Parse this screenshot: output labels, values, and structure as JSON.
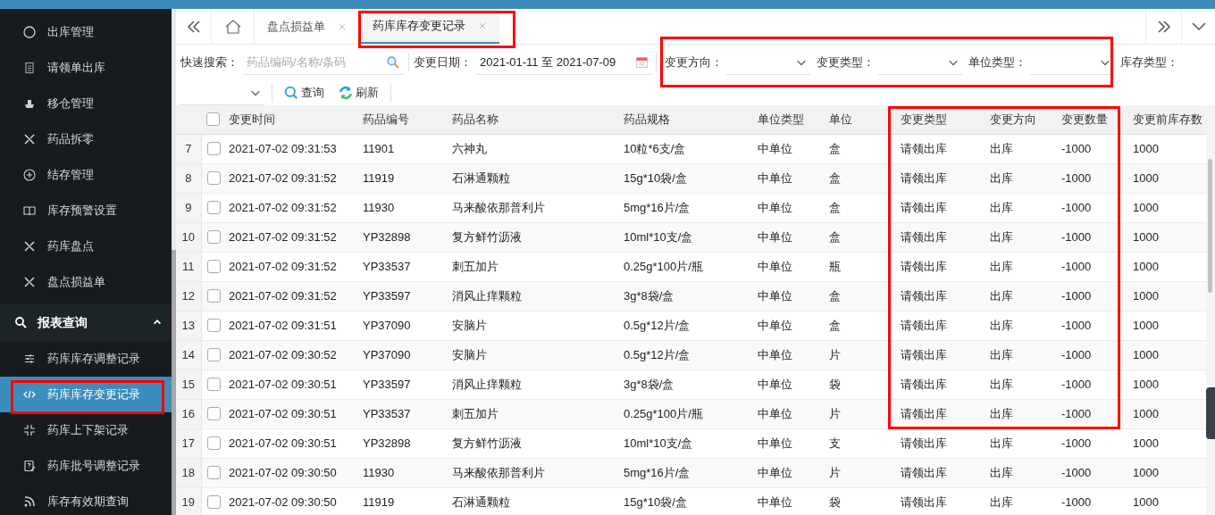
{
  "sidebar": {
    "items": [
      {
        "label": "出库管理",
        "selected": false
      },
      {
        "label": "请领单出库",
        "selected": false
      },
      {
        "label": "移仓管理",
        "selected": false
      },
      {
        "label": "药品拆零",
        "selected": false
      },
      {
        "label": "结存管理",
        "selected": false
      },
      {
        "label": "库存预警设置",
        "selected": false
      },
      {
        "label": "药库盘点",
        "selected": false
      },
      {
        "label": "盘点损益单",
        "selected": false
      }
    ],
    "section": {
      "label": "报表查询",
      "expanded": true,
      "children": [
        {
          "label": "药库库存调整记录",
          "selected": false
        },
        {
          "label": "药库库存变更记录",
          "selected": true
        },
        {
          "label": "药库上下架记录",
          "selected": false
        },
        {
          "label": "药库批号调整记录",
          "selected": false
        },
        {
          "label": "库存有效期查询",
          "selected": false
        }
      ]
    }
  },
  "tabs": [
    {
      "label": "盘点损益单",
      "selected": false
    },
    {
      "label": "药库库存变更记录",
      "selected": true
    }
  ],
  "filters": {
    "search": {
      "label": "快速搜索：",
      "placeholder": "药品编码/名称/条码"
    },
    "date": {
      "label": "变更日期：",
      "value": "2021-01-11 至 2021-07-09"
    },
    "selects": [
      {
        "label": "变更方向："
      },
      {
        "label": "变更类型："
      },
      {
        "label": "单位类型："
      },
      {
        "label": "库存类型："
      }
    ],
    "buttons": [
      {
        "kind": "search",
        "label": "查询"
      },
      {
        "kind": "refresh",
        "label": "刷新"
      }
    ]
  },
  "table": {
    "all_checked": false,
    "columns": [
      "变更时间",
      "药品编号",
      "药品名称",
      "药品规格",
      "单位类型",
      "单位",
      "变更类型",
      "变更方向",
      "变更数量",
      "变更前库存数"
    ],
    "rows": [
      {
        "index": "7",
        "checked": false,
        "cells": [
          "2021-07-02 09:31:53",
          "11901",
          "六神丸",
          "10粒*6支/盒",
          "中单位",
          "盒",
          "请领出库",
          "出库",
          "-1000",
          "1000"
        ]
      },
      {
        "index": "8",
        "checked": false,
        "cells": [
          "2021-07-02 09:31:52",
          "11919",
          "石淋通颗粒",
          "15g*10袋/盒",
          "中单位",
          "盒",
          "请领出库",
          "出库",
          "-1000",
          "1000"
        ]
      },
      {
        "index": "9",
        "checked": false,
        "cells": [
          "2021-07-02 09:31:52",
          "11930",
          "马来酸依那普利片",
          "5mg*16片/盒",
          "中单位",
          "盒",
          "请领出库",
          "出库",
          "-1000",
          "1000"
        ]
      },
      {
        "index": "10",
        "checked": false,
        "cells": [
          "2021-07-02 09:31:52",
          "YP32898",
          "复方鲜竹沥液",
          "10ml*10支/盒",
          "中单位",
          "盒",
          "请领出库",
          "出库",
          "-1000",
          "1000"
        ]
      },
      {
        "index": "11",
        "checked": false,
        "cells": [
          "2021-07-02 09:31:52",
          "YP33537",
          "刺五加片",
          "0.25g*100片/瓶",
          "中单位",
          "瓶",
          "请领出库",
          "出库",
          "-1000",
          "1000"
        ]
      },
      {
        "index": "12",
        "checked": false,
        "cells": [
          "2021-07-02 09:31:52",
          "YP33597",
          "消风止痒颗粒",
          "3g*8袋/盒",
          "中单位",
          "盒",
          "请领出库",
          "出库",
          "-1000",
          "1000"
        ]
      },
      {
        "index": "13",
        "checked": false,
        "cells": [
          "2021-07-02 09:31:51",
          "YP37090",
          "安脑片",
          "0.5g*12片/盒",
          "中单位",
          "盒",
          "请领出库",
          "出库",
          "-1000",
          "1000"
        ]
      },
      {
        "index": "14",
        "checked": false,
        "cells": [
          "2021-07-02 09:30:52",
          "YP37090",
          "安脑片",
          "0.5g*12片/盒",
          "中单位",
          "片",
          "请领出库",
          "出库",
          "-1000",
          "1000"
        ]
      },
      {
        "index": "15",
        "checked": false,
        "cells": [
          "2021-07-02 09:30:51",
          "YP33597",
          "消风止痒颗粒",
          "3g*8袋/盒",
          "中单位",
          "袋",
          "请领出库",
          "出库",
          "-1000",
          "1000"
        ]
      },
      {
        "index": "16",
        "checked": false,
        "cells": [
          "2021-07-02 09:30:51",
          "YP33537",
          "刺五加片",
          "0.25g*100片/瓶",
          "中单位",
          "片",
          "请领出库",
          "出库",
          "-1000",
          "1000"
        ]
      },
      {
        "index": "17",
        "checked": false,
        "cells": [
          "2021-07-02 09:30:51",
          "YP32898",
          "复方鲜竹沥液",
          "10ml*10支/盒",
          "中单位",
          "支",
          "请领出库",
          "出库",
          "-1000",
          "1000"
        ]
      },
      {
        "index": "18",
        "checked": false,
        "cells": [
          "2021-07-02 09:30:50",
          "11930",
          "马来酸依那普利片",
          "5mg*16片/盒",
          "中单位",
          "片",
          "请领出库",
          "出库",
          "-1000",
          "1000"
        ]
      },
      {
        "index": "19",
        "checked": false,
        "cells": [
          "2021-07-02 09:30:50",
          "11919",
          "石淋通颗粒",
          "15g*10袋/盒",
          "中单位",
          "袋",
          "请领出库",
          "出库",
          "-1000",
          "1000"
        ]
      }
    ]
  }
}
